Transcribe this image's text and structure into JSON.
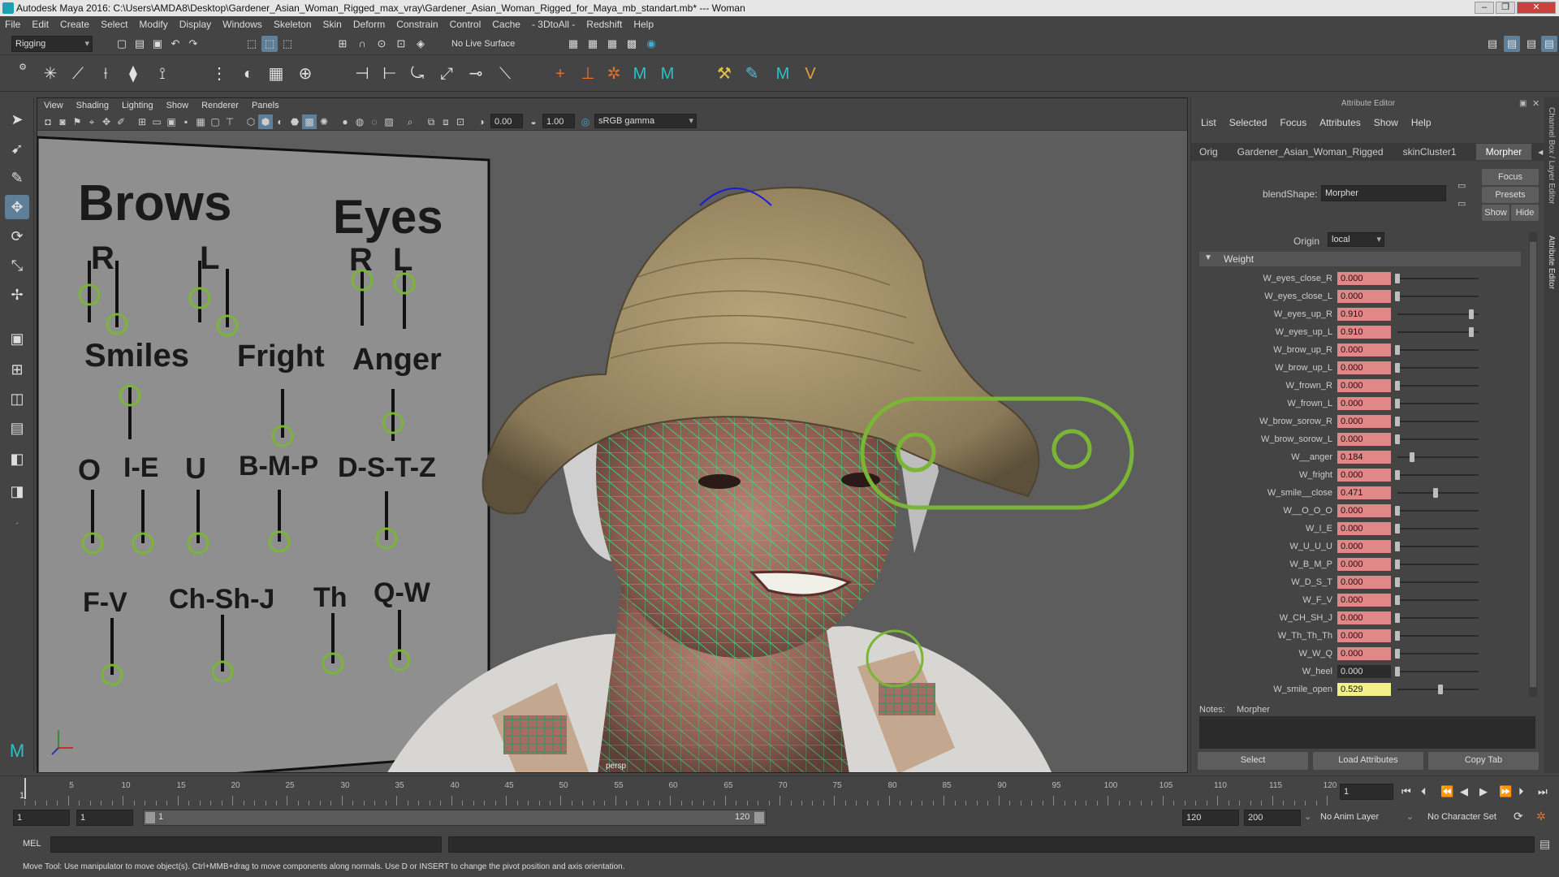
{
  "title": "Autodesk Maya 2016: C:\\Users\\AMDA8\\Desktop\\Gardener_Asian_Woman_Rigged_max_vray\\Gardener_Asian_Woman_Rigged_for_Maya_mb_standart.mb* --- Woman",
  "menu": [
    "File",
    "Edit",
    "Create",
    "Select",
    "Modify",
    "Display",
    "Windows",
    "Skeleton",
    "Skin",
    "Deform",
    "Constrain",
    "Control",
    "Cache",
    "- 3DtoAll -",
    "Redshift",
    "Help"
  ],
  "status": {
    "mode": "Rigging",
    "live_surface": "No Live Surface"
  },
  "viewport": {
    "menu": [
      "View",
      "Shading",
      "Lighting",
      "Show",
      "Renderer",
      "Panels"
    ],
    "exposure": "0.00",
    "gamma": "1.00",
    "colorspace": "sRGB gamma",
    "camera": "persp",
    "board": {
      "brows": "Brows",
      "eyes": "Eyes",
      "r1": "R",
      "l1": "L",
      "r2": "R",
      "l2": "L",
      "smiles": "Smiles",
      "fright": "Fright",
      "anger": "Anger",
      "o": "O",
      "ie": "I-E",
      "u": "U",
      "bmp": "B-M-P",
      "dstz": "D-S-T-Z",
      "fv": "F-V",
      "chshj": "Ch-Sh-J",
      "th": "Th",
      "qw": "Q-W"
    }
  },
  "attr": {
    "title": "Attribute Editor",
    "menu": [
      "List",
      "Selected",
      "Focus",
      "Attributes",
      "Show",
      "Help"
    ],
    "tabs": [
      "Orig",
      "Gardener_Asian_Woman_Rigged",
      "skinCluster1",
      "Morpher"
    ],
    "blendshape_label": "blendShape:",
    "blendshape_value": "Morpher",
    "focus": "Focus",
    "presets": "Presets",
    "show": "Show",
    "hide": "Hide",
    "origin_label": "Origin",
    "origin_value": "local",
    "section": "Weight",
    "weights": [
      {
        "name": "W_eyes_close_R",
        "value": "0.000",
        "frac": 0.0
      },
      {
        "name": "W_eyes_close_L",
        "value": "0.000",
        "frac": 0.0
      },
      {
        "name": "W_eyes_up_R",
        "value": "0.910",
        "frac": 0.91
      },
      {
        "name": "W_eyes_up_L",
        "value": "0.910",
        "frac": 0.91
      },
      {
        "name": "W_brow_up_R",
        "value": "0.000",
        "frac": 0.0
      },
      {
        "name": "W_brow_up_L",
        "value": "0.000",
        "frac": 0.0
      },
      {
        "name": "W_frown_R",
        "value": "0.000",
        "frac": 0.0
      },
      {
        "name": "W_frown_L",
        "value": "0.000",
        "frac": 0.0
      },
      {
        "name": "W_brow_sorow_R",
        "value": "0.000",
        "frac": 0.0
      },
      {
        "name": "W_brow_sorow_L",
        "value": "0.000",
        "frac": 0.0
      },
      {
        "name": "W__anger",
        "value": "0.184",
        "frac": 0.184
      },
      {
        "name": "W_fright",
        "value": "0.000",
        "frac": 0.0
      },
      {
        "name": "W_smile__close",
        "value": "0.471",
        "frac": 0.471
      },
      {
        "name": "W__O_O_O",
        "value": "0.000",
        "frac": 0.0
      },
      {
        "name": "W_I_E",
        "value": "0.000",
        "frac": 0.0
      },
      {
        "name": "W_U_U_U",
        "value": "0.000",
        "frac": 0.0
      },
      {
        "name": "W_B_M_P",
        "value": "0.000",
        "frac": 0.0
      },
      {
        "name": "W_D_S_T",
        "value": "0.000",
        "frac": 0.0
      },
      {
        "name": "W_F_V",
        "value": "0.000",
        "frac": 0.0
      },
      {
        "name": "W_CH_SH_J",
        "value": "0.000",
        "frac": 0.0
      },
      {
        "name": "W_Th_Th_Th",
        "value": "0.000",
        "frac": 0.0
      },
      {
        "name": "W_W_Q",
        "value": "0.000",
        "frac": 0.0
      },
      {
        "name": "W_heel",
        "value": "0.000",
        "frac": 0.0
      },
      {
        "name": "W_smile_open",
        "value": "0.529",
        "frac": 0.529
      }
    ],
    "notes_label": "Notes:",
    "notes_value": "Morpher",
    "select": "Select",
    "load": "Load Attributes",
    "copy": "Copy Tab"
  },
  "timeline": {
    "ticks": [
      "5",
      "10",
      "15",
      "20",
      "25",
      "30",
      "35",
      "40",
      "45",
      "50",
      "55",
      "60",
      "65",
      "70",
      "75",
      "80",
      "85",
      "90",
      "95",
      "100",
      "105",
      "110",
      "115",
      "120"
    ],
    "start": "1",
    "current": "1"
  },
  "range": {
    "start": "1",
    "inner_start": "1",
    "slider_start": "1",
    "slider_end": "120",
    "end": "120",
    "max": "200",
    "anim_layer": "No Anim Layer",
    "char_set": "No Character Set"
  },
  "cmd": {
    "label": "MEL"
  },
  "help": "Move Tool: Use manipulator to move object(s). Ctrl+MMB+drag to move components along normals. Use D or INSERT to change the pivot position and axis orientation.",
  "sidetabs": {
    "channel": "Channel Box / Layer Editor",
    "attribute": "Attribute Editor"
  },
  "colors": {
    "weight_field": "#e08888",
    "weight_highlight": "#f3ef8a",
    "rig": "#7ab536"
  }
}
